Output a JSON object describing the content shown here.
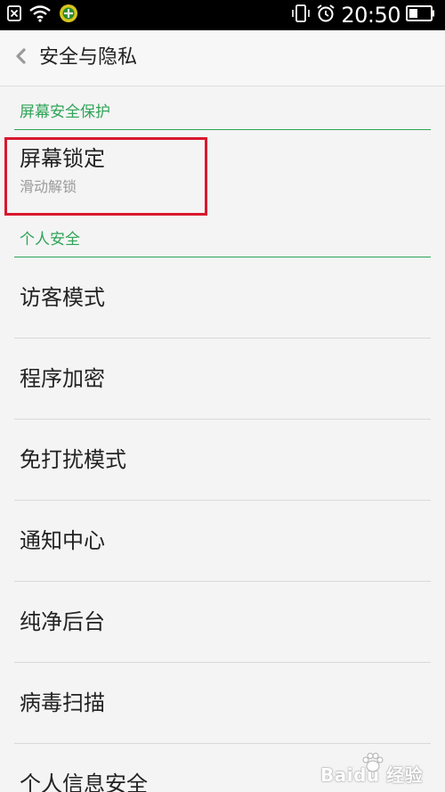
{
  "status_bar": {
    "time": "20:50",
    "icons": [
      "notification-close-icon",
      "wifi-icon",
      "app-notification-icon",
      "vibrate-icon",
      "alarm-icon",
      "battery-icon"
    ]
  },
  "header": {
    "back_icon": "chevron-left-icon",
    "title": "安全与隐私"
  },
  "sections": {
    "screen_security": {
      "title": "屏幕安全保护",
      "items": [
        {
          "label": "屏幕锁定",
          "value": "滑动解锁"
        }
      ]
    },
    "personal_security": {
      "title": "个人安全",
      "items": [
        {
          "label": "访客模式"
        },
        {
          "label": "程序加密"
        },
        {
          "label": "免打扰模式"
        },
        {
          "label": "通知中心"
        },
        {
          "label": "纯净后台"
        },
        {
          "label": "病毒扫描"
        },
        {
          "label": "个人信息安全"
        }
      ]
    }
  },
  "watermark": {
    "text": "Baidu 经验"
  },
  "colors": {
    "accent_green": "#2ea457",
    "highlight_red": "#d8182e",
    "background": "#f4f4f4",
    "status_bar": "#000000"
  }
}
